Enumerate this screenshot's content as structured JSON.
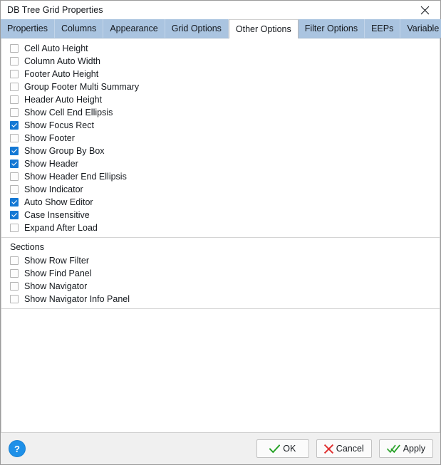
{
  "window": {
    "title": "DB Tree Grid Properties",
    "close_icon": "close-icon"
  },
  "tabs": {
    "items": [
      {
        "label": "Properties",
        "active": false
      },
      {
        "label": "Columns",
        "active": false
      },
      {
        "label": "Appearance",
        "active": false
      },
      {
        "label": "Grid Options",
        "active": false
      },
      {
        "label": "Other Options",
        "active": true
      },
      {
        "label": "Filter Options",
        "active": false
      },
      {
        "label": "EEPs",
        "active": false
      },
      {
        "label": "Variable Links",
        "active": false
      }
    ],
    "overflow_icon": "chevron-down-icon"
  },
  "options": {
    "items": [
      {
        "label": "Cell Auto Height",
        "checked": false
      },
      {
        "label": "Column Auto Width",
        "checked": false
      },
      {
        "label": "Footer Auto Height",
        "checked": false
      },
      {
        "label": "Group Footer Multi Summary",
        "checked": false
      },
      {
        "label": "Header Auto Height",
        "checked": false
      },
      {
        "label": "Show Cell End Ellipsis",
        "checked": false
      },
      {
        "label": "Show Focus Rect",
        "checked": true
      },
      {
        "label": "Show Footer",
        "checked": false
      },
      {
        "label": "Show Group By Box",
        "checked": true
      },
      {
        "label": "Show Header",
        "checked": true
      },
      {
        "label": "Show Header End Ellipsis",
        "checked": false
      },
      {
        "label": "Show Indicator",
        "checked": false
      },
      {
        "label": "Auto Show Editor",
        "checked": true
      },
      {
        "label": "Case Insensitive",
        "checked": true
      },
      {
        "label": "Expand After Load",
        "checked": false
      }
    ]
  },
  "sections": {
    "title": "Sections",
    "items": [
      {
        "label": "Show Row Filter",
        "checked": false
      },
      {
        "label": "Show Find Panel",
        "checked": false
      },
      {
        "label": "Show Navigator",
        "checked": false
      },
      {
        "label": "Show Navigator Info Panel",
        "checked": false
      }
    ]
  },
  "footer": {
    "help_label": "?",
    "ok_label": "OK",
    "cancel_label": "Cancel",
    "apply_label": "Apply",
    "ok_icon": "check-icon",
    "cancel_icon": "x-icon",
    "apply_icon": "double-check-icon"
  },
  "colors": {
    "tab_strip": "#aac4e0",
    "checkbox_checked": "#1478d4",
    "help_button": "#1e90e8",
    "ok_check": "#22a022",
    "cancel_x": "#e03131",
    "apply_check": "#22a022"
  }
}
